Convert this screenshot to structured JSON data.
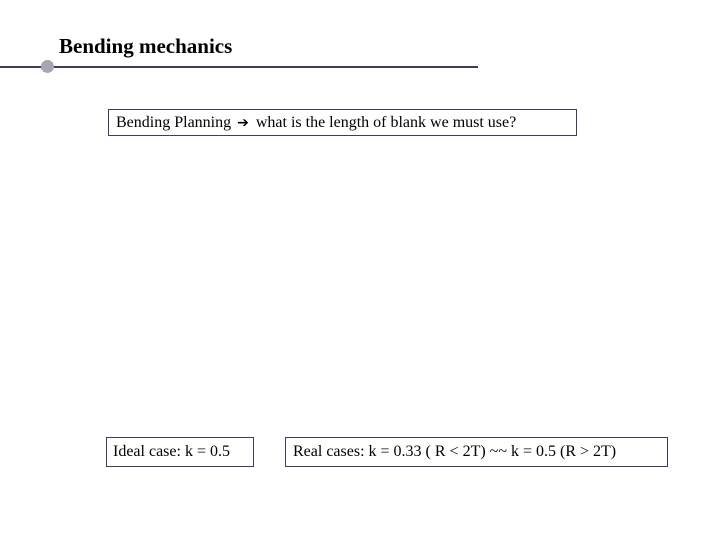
{
  "slide": {
    "title": "Bending mechanics",
    "planning_box": {
      "label_before": "Bending Planning",
      "icon": "arrow-right-icon",
      "arrow_glyph": "➔",
      "label_after": "what is the length of blank we must use?"
    },
    "ideal_box": {
      "text": "Ideal case: k = 0.5"
    },
    "real_box": {
      "text": "Real cases: k = 0.33 ( R < 2T) ~~ k = 0.5 (R > 2T)"
    }
  },
  "colors": {
    "accent_line": "#3c3c5c",
    "text": "#000000",
    "background": "#ffffff"
  }
}
